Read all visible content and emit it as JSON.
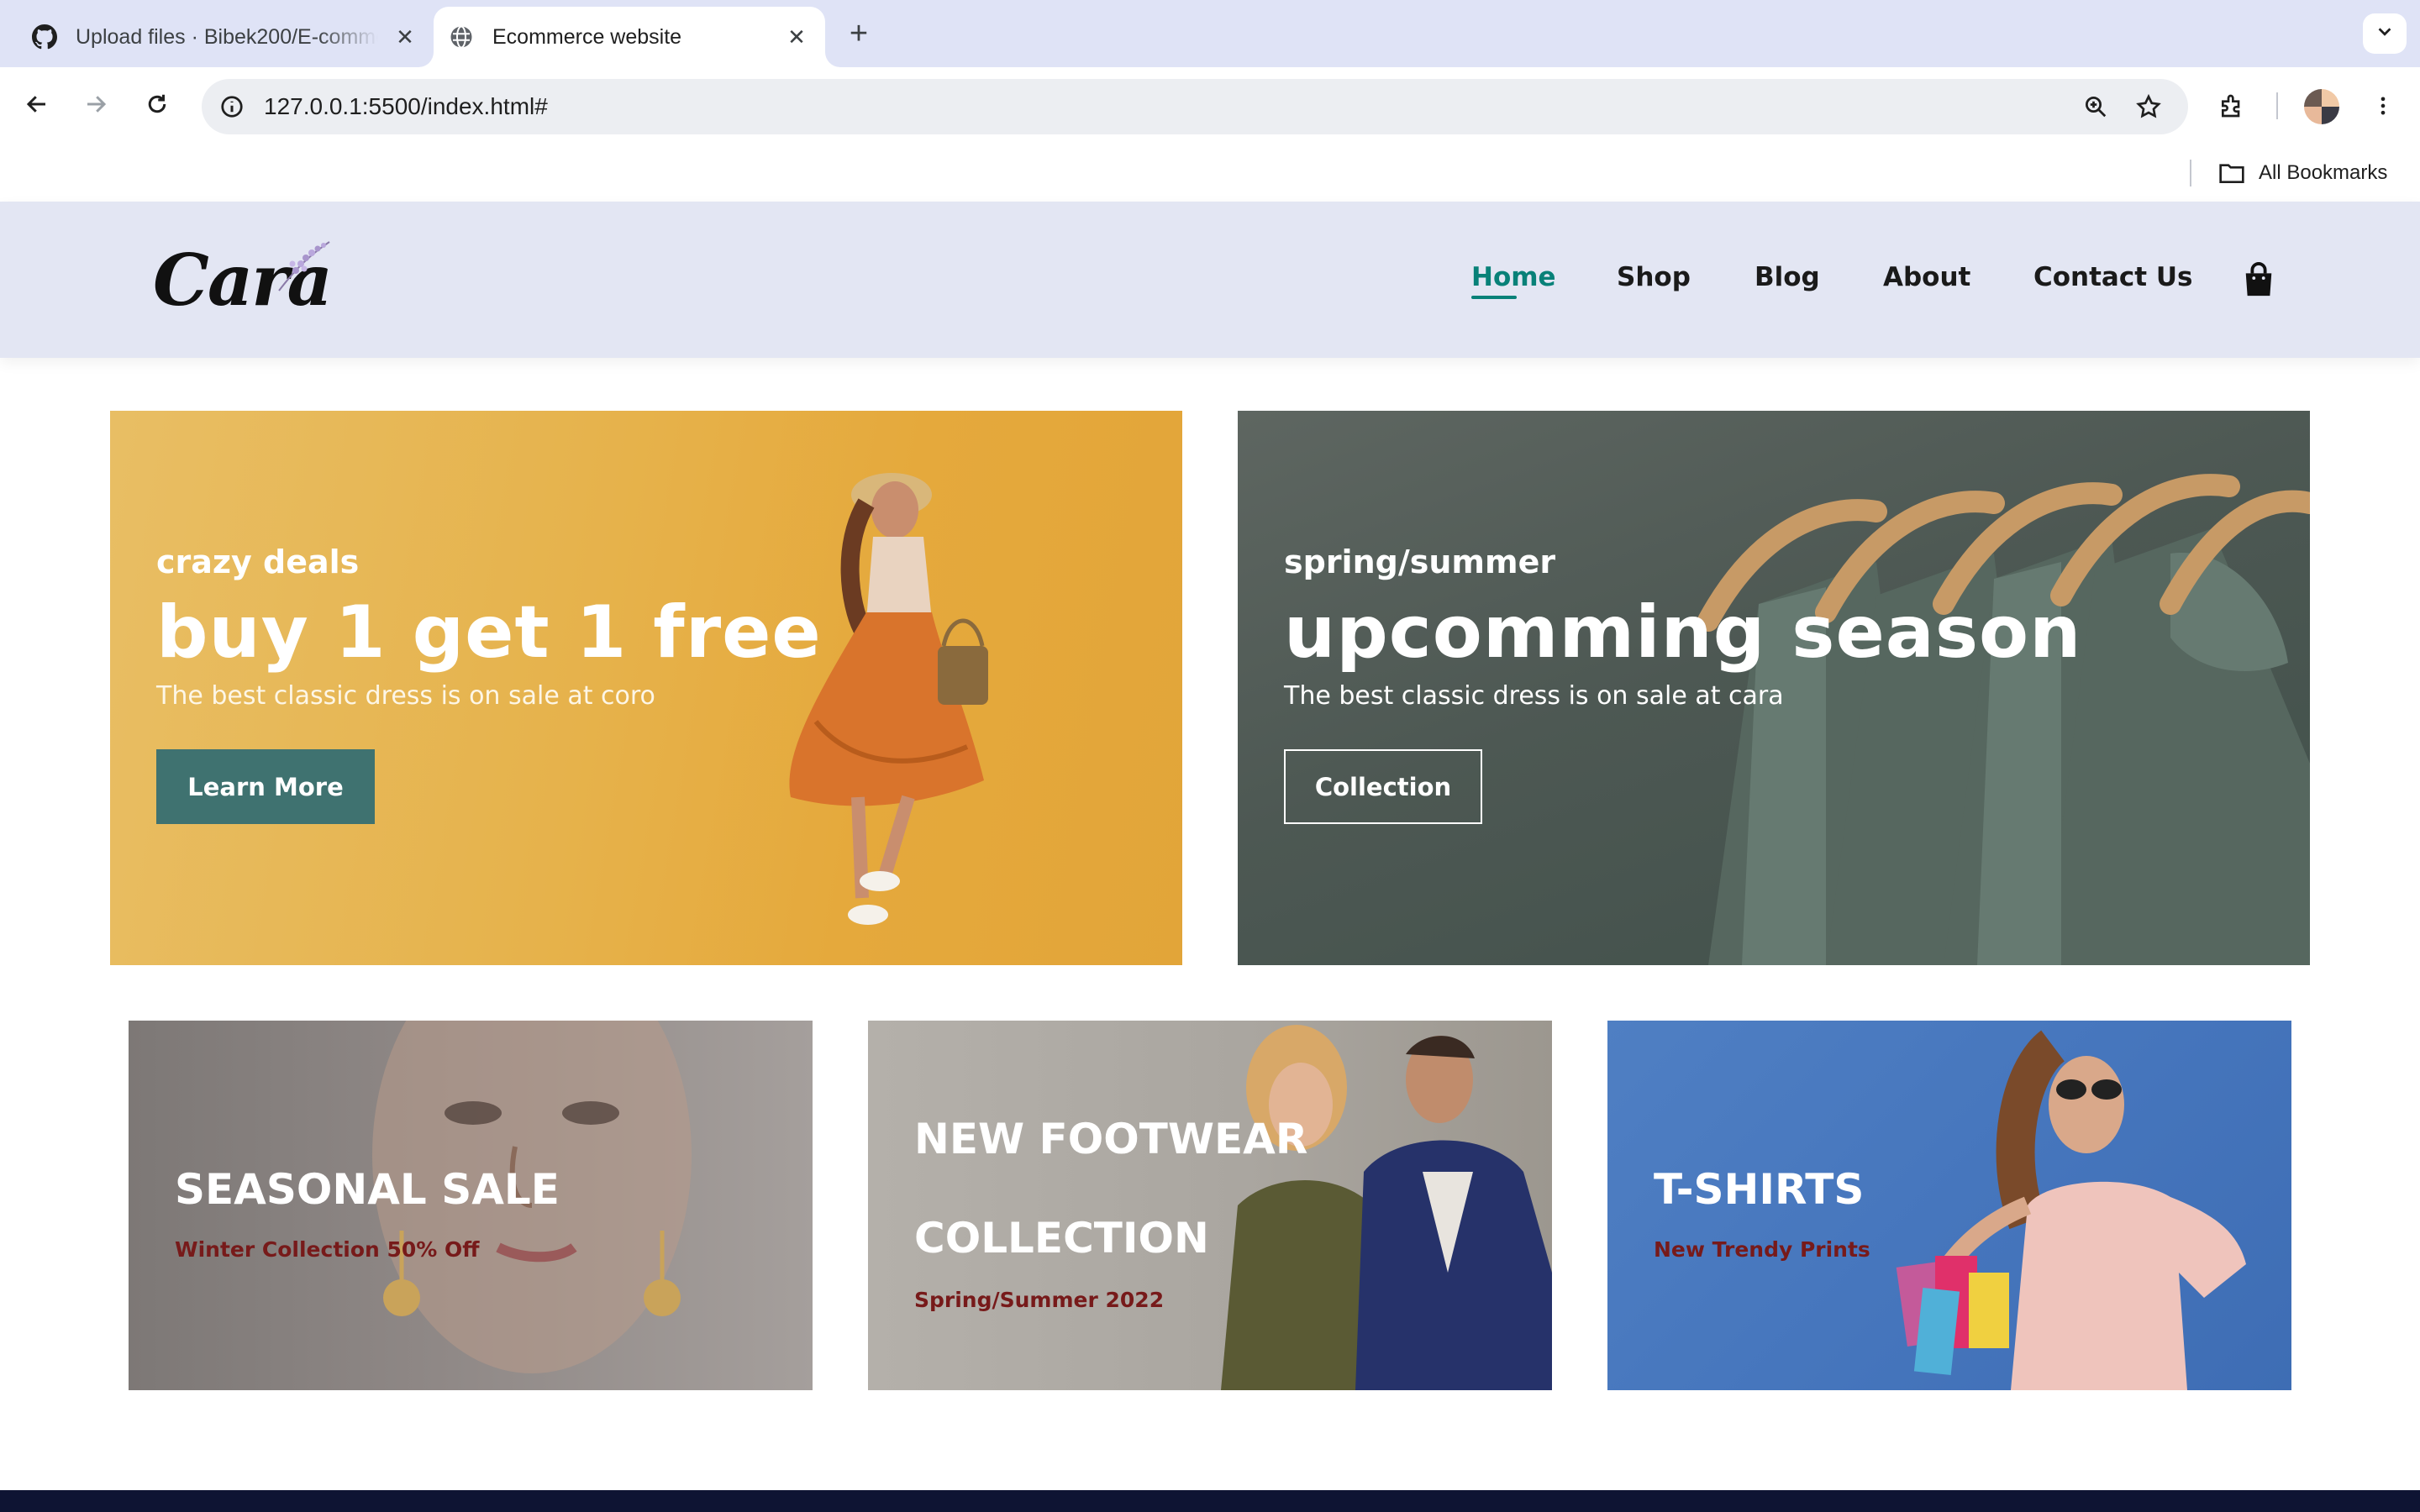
{
  "browser": {
    "tabs": [
      {
        "title": "Upload files · Bibek200/E-commerce",
        "favicon": "github-icon",
        "active": false
      },
      {
        "title": "Ecommerce website",
        "favicon": "globe-icon",
        "active": true
      }
    ],
    "address": "127.0.0.1:5500/index.html#",
    "bookmarks_label": "All Bookmarks"
  },
  "site": {
    "logo_text": "Cara",
    "nav": [
      "Home",
      "Shop",
      "Blog",
      "About",
      "Contact Us"
    ],
    "active_nav": "Home",
    "accent_color": "#088178"
  },
  "banners": {
    "deals": {
      "kicker": "crazy deals",
      "headline": "buy 1 get 1 free",
      "subtext": "The best classic dress is on sale at coro",
      "button": "Learn More"
    },
    "season": {
      "kicker": "spring/summer",
      "headline": "upcomming season",
      "subtext": "The best classic dress is on sale at cara",
      "button": "Collection"
    },
    "small": [
      {
        "title": "SEASONAL SALE",
        "subtitle": "Winter Collection 50% Off"
      },
      {
        "title": "NEW FOOTWEAR",
        "title2": "COLLECTION",
        "subtitle": "Spring/Summer 2022"
      },
      {
        "title": "T-SHIRTS",
        "subtitle": "New Trendy Prints"
      }
    ]
  }
}
